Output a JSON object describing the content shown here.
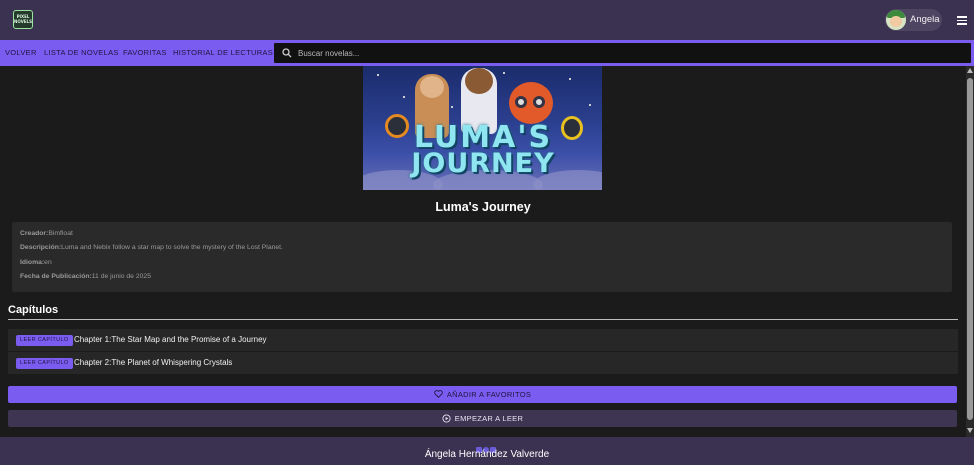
{
  "header": {
    "logo_text": "PIXEL NOVELS",
    "user_name": "Angela"
  },
  "nav": {
    "items": [
      "VOLVER",
      "LISTA DE NOVELAS",
      "FAVORITAS",
      "HISTORIAL DE LECTURAS"
    ],
    "search_placeholder": "Buscar novelas..."
  },
  "novel": {
    "cover_title_line1": "LUMA'S",
    "cover_title_line2": "JOURNEY",
    "title": "Luma's Journey",
    "creator_label": "Creador:",
    "creator": "Bimfloat",
    "description_label": "Descripción:",
    "description": "Luma and Nebix follow a star map to solve the mystery of the Lost Planet.",
    "language_label": "Idioma:",
    "language": "en",
    "date_label": "Fecha de Publicación:",
    "date": "11 de junio de 2025"
  },
  "chapters": {
    "heading": "Capítulos",
    "read_label": "LEER CAPÍTULO",
    "items": [
      {
        "title": "Chapter 1:The Star Map and the Promise of a Journey"
      },
      {
        "title": "Chapter 2:The Planet of Whispering Crystals"
      }
    ]
  },
  "actions": {
    "favorite_label": "AÑADIR A FAVORITOS",
    "start_label": "EMPEZAR A LEER"
  },
  "footer": {
    "author": "Ángela Hernández Valverde",
    "icons": [
      "linkedin-icon",
      "github-icon",
      "mail-icon"
    ]
  },
  "colors": {
    "accent": "#7a5cf0",
    "topbar": "#3b3150",
    "background": "#1b1b1b"
  }
}
